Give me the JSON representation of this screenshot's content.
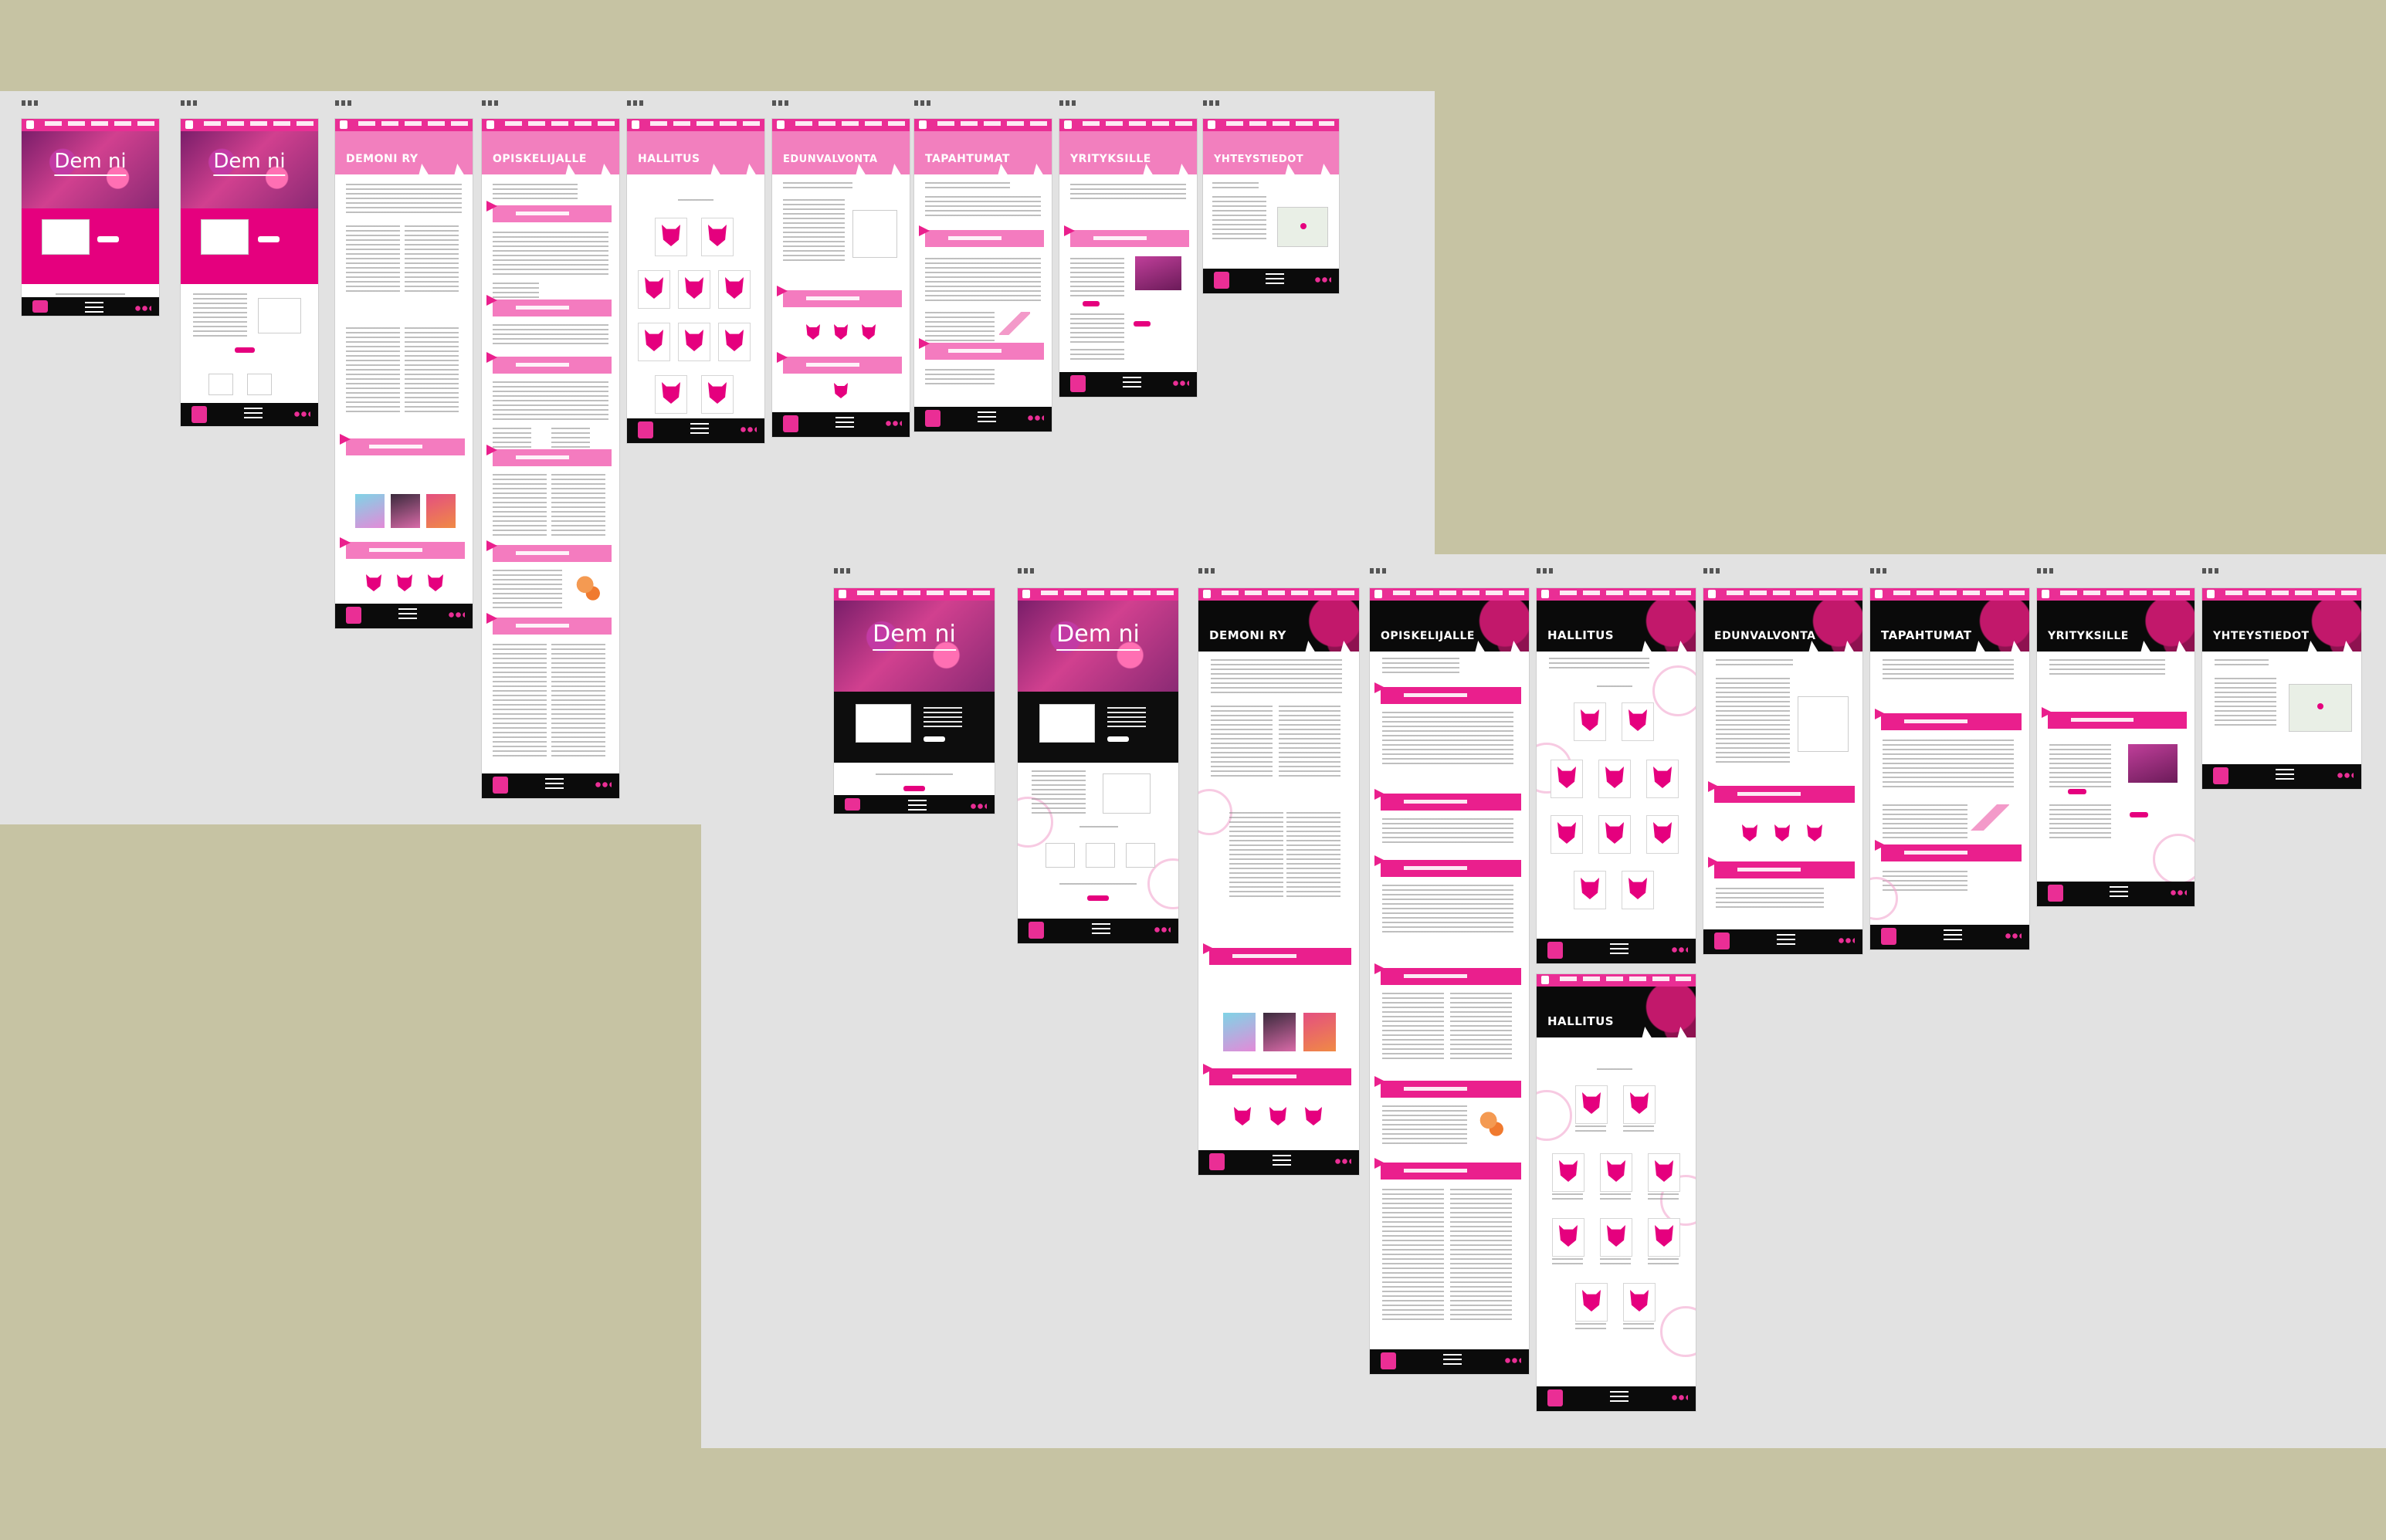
{
  "canvas": {
    "background": "#c6c3a3",
    "board_color": "#e2e2e2"
  },
  "brand": {
    "accent": "#e5007e",
    "nav_pink": "#ea2e95",
    "hero_title": "Dem  ni",
    "footer_black": "#0b0b0b"
  },
  "frames_v1": {
    "f1": {
      "label": "etusivu-1"
    },
    "f2": {
      "label": "etusivu-2"
    },
    "f3": {
      "title": "DEMONI RY"
    },
    "f4": {
      "title": "OPISKELIJALLE"
    },
    "f5": {
      "title": "HALLITUS"
    },
    "f6": {
      "title": "EDUNVALVONTA"
    },
    "f7": {
      "title": "TAPAHTUMAT"
    },
    "f8": {
      "title": "YRITYKSILLE"
    },
    "f9": {
      "title": "YHTEYSTIEDOT"
    }
  },
  "frames_v2": {
    "f3": {
      "title": "DEMONI RY"
    },
    "f4": {
      "title": "OPISKELIJALLE"
    },
    "f5": {
      "title": "HALLITUS"
    },
    "f6": {
      "title": "EDUNVALVONTA"
    },
    "f7": {
      "title": "TAPAHTUMAT"
    },
    "f8": {
      "title": "YRITYKSILLE"
    },
    "f9": {
      "title": "YHTEYSTIEDOT"
    },
    "f10": {
      "title": "HALLITUS"
    }
  }
}
